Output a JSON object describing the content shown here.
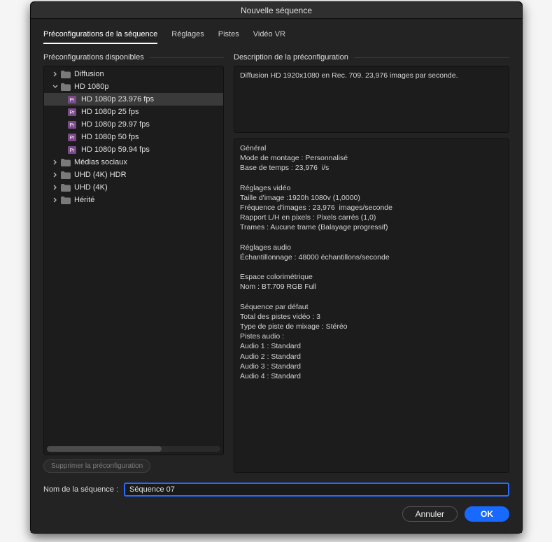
{
  "window": {
    "title": "Nouvelle séquence"
  },
  "tabs": [
    {
      "label": "Préconfigurations de la séquence",
      "active": true
    },
    {
      "label": "Réglages",
      "active": false
    },
    {
      "label": "Pistes",
      "active": false
    },
    {
      "label": "Vidéo VR",
      "active": false
    }
  ],
  "left_header": "Préconfigurations disponibles",
  "right_header": "Description de la préconfiguration",
  "tree": [
    {
      "type": "folder",
      "depth": 0,
      "expanded": false,
      "label": "Diffusion"
    },
    {
      "type": "folder",
      "depth": 0,
      "expanded": true,
      "label": "HD 1080p"
    },
    {
      "type": "preset",
      "depth": 1,
      "label": "HD 1080p 23.976 fps",
      "selected": true
    },
    {
      "type": "preset",
      "depth": 1,
      "label": "HD 1080p 25 fps"
    },
    {
      "type": "preset",
      "depth": 1,
      "label": "HD 1080p 29.97 fps"
    },
    {
      "type": "preset",
      "depth": 1,
      "label": "HD 1080p 50 fps"
    },
    {
      "type": "preset",
      "depth": 1,
      "label": "HD 1080p 59.94 fps"
    },
    {
      "type": "folder",
      "depth": 0,
      "expanded": false,
      "label": "Médias sociaux"
    },
    {
      "type": "folder",
      "depth": 0,
      "expanded": false,
      "label": "UHD (4K) HDR"
    },
    {
      "type": "folder",
      "depth": 0,
      "expanded": false,
      "label": "UHD (4K)"
    },
    {
      "type": "folder",
      "depth": 0,
      "expanded": false,
      "label": "Hérité"
    }
  ],
  "delete_button": "Supprimer la préconfiguration",
  "desc_top": "Diffusion HD 1920x1080 en Rec. 709. 23,976 images par seconde.",
  "desc_main": "Général\nMode de montage : Personnalisé\nBase de temps : 23,976  i/s\n\nRéglages vidéo\nTaille d'image :1920h 1080v (1,0000)\nFréquence d'images : 23,976  images/seconde\nRapport L/H en pixels : Pixels carrés (1,0)\nTrames : Aucune trame (Balayage progressif)\n\nRéglages audio\nÉchantillonnage : 48000 échantillons/seconde\n\nEspace colorimétrique\nNom : BT.709 RGB Full\n\nSéquence par défaut\nTotal des pistes vidéo : 3\nType de piste de mixage : Stéréo\nPistes audio :\nAudio 1 : Standard\nAudio 2 : Standard\nAudio 3 : Standard\nAudio 4 : Standard",
  "sequence_name_label": "Nom de la séquence :",
  "sequence_name_value": "Séquence 07",
  "cancel_label": "Annuler",
  "ok_label": "OK"
}
